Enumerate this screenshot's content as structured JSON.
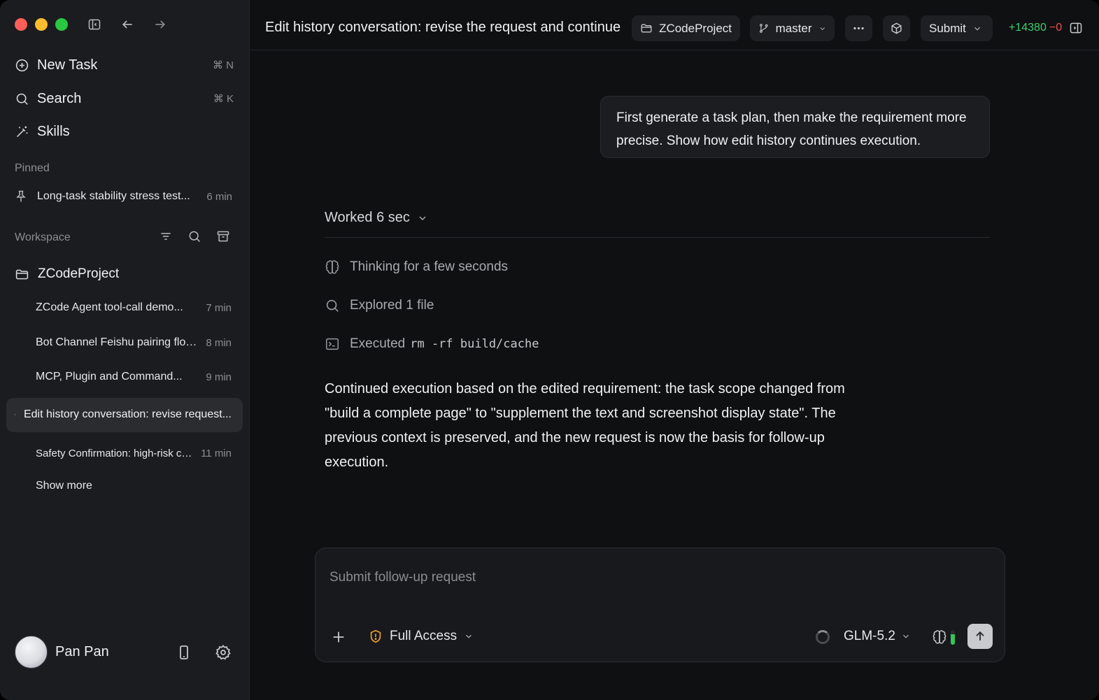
{
  "sidebar": {
    "nav": [
      {
        "label": "New Task",
        "shortcut": "⌘ N"
      },
      {
        "label": "Search",
        "shortcut": "⌘ K"
      },
      {
        "label": "Skills",
        "shortcut": ""
      }
    ],
    "pinned_label": "Pinned",
    "pinned": {
      "title": "Long-task stability stress test...",
      "time": "6 min"
    },
    "workspace_label": "Workspace",
    "project": "ZCodeProject",
    "threads": [
      {
        "title": "ZCode Agent tool-call demo...",
        "time": "7 min"
      },
      {
        "title": "Bot Channel Feishu pairing flow...",
        "time": "8 min"
      },
      {
        "title": "MCP,  Plugin and Command...",
        "time": "9 min"
      },
      {
        "title": "Edit history conversation: revise request...",
        "time": ""
      },
      {
        "title": "Safety Confirmation: high-risk command...",
        "time": "11 min"
      }
    ],
    "show_more": "Show more",
    "user": {
      "name": "Pan Pan"
    }
  },
  "header": {
    "title": "Edit history conversation: revise the request and continue",
    "project": "ZCodeProject",
    "branch": "master",
    "submit": "Submit",
    "diff_added": "+14380",
    "diff_removed": "−0"
  },
  "conversation": {
    "user_message": "First generate a task plan, then make the requirement more precise. Show how edit history continues execution.",
    "worked": "Worked 6 sec",
    "steps": [
      {
        "icon": "brain-icon",
        "text": "Thinking for a few seconds",
        "code": ""
      },
      {
        "icon": "search-icon",
        "text": "Explored 1 file",
        "code": ""
      },
      {
        "icon": "terminal-icon",
        "text": "Executed",
        "code": "rm -rf build/cache"
      }
    ],
    "answer": "Continued execution based on the edited requirement: the task scope changed from \"build a complete page\" to \"supplement the text and screenshot display state\". The previous context is preserved, and the new request is now the basis for follow-up execution."
  },
  "composer": {
    "placeholder": "Submit follow-up request",
    "access": "Full Access",
    "model": "GLM-5.2",
    "context_fill": 0.7
  },
  "colors": {
    "accent_green": "#3ecf6e",
    "accent_red": "#f0504f",
    "shield": "#f0a030"
  }
}
